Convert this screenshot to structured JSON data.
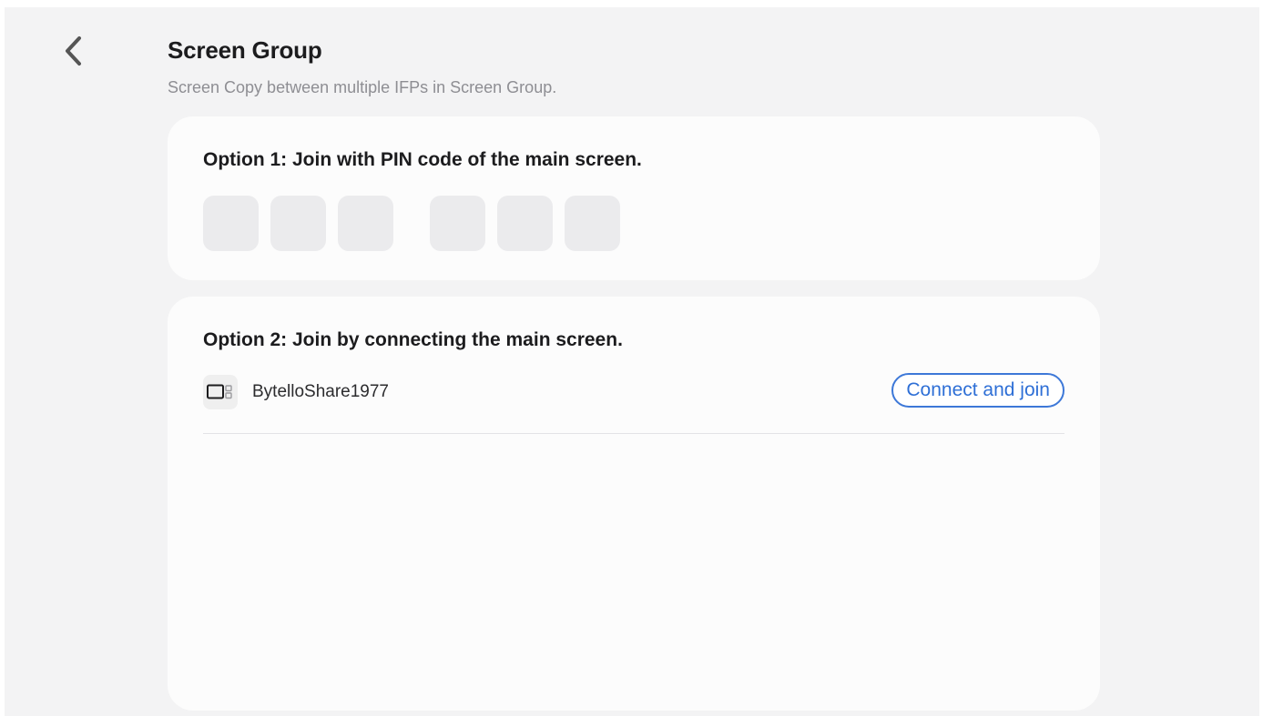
{
  "header": {
    "back_icon": "chevron-left-icon",
    "title": "Screen Group",
    "subtitle": "Screen Copy between multiple IFPs in Screen Group."
  },
  "option1": {
    "heading": "Option 1: Join with PIN code of the main screen.",
    "pin_values": [
      "",
      "",
      "",
      "",
      "",
      ""
    ]
  },
  "option2": {
    "heading": "Option 2: Join by connecting the main screen.",
    "devices": [
      {
        "icon": "display-device-icon",
        "name": "BytelloShare1977",
        "action_label": "Connect and join"
      }
    ]
  },
  "colors": {
    "accent": "#2e6fd6",
    "background": "#f3f3f4",
    "card": "#fcfcfc",
    "pin_box": "#ebebed"
  }
}
